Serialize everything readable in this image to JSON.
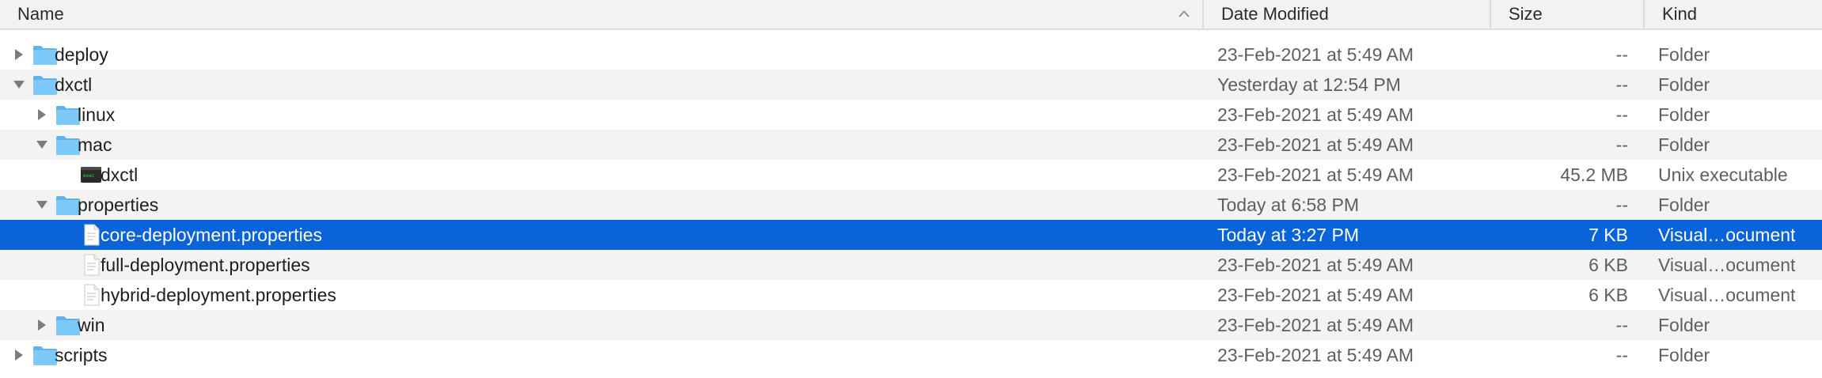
{
  "columns": {
    "name": "Name",
    "date": "Date Modified",
    "size": "Size",
    "kind": "Kind"
  },
  "sort": {
    "column": "name",
    "direction": "ascending"
  },
  "colors": {
    "selection": "#0a63d8",
    "folder": "#6cbff4"
  },
  "rows": [
    {
      "name": "deploy",
      "date": "23-Feb-2021 at 5:49 AM",
      "size": "--",
      "kind": "Folder",
      "depth": 0,
      "icon": "folder-icon",
      "disclosure": "collapsed"
    },
    {
      "name": "dxctl",
      "date": "Yesterday at 12:54 PM",
      "size": "--",
      "kind": "Folder",
      "depth": 0,
      "icon": "folder-icon",
      "disclosure": "expanded"
    },
    {
      "name": "linux",
      "date": "23-Feb-2021 at 5:49 AM",
      "size": "--",
      "kind": "Folder",
      "depth": 1,
      "icon": "folder-icon",
      "disclosure": "collapsed"
    },
    {
      "name": "mac",
      "date": "23-Feb-2021 at 5:49 AM",
      "size": "--",
      "kind": "Folder",
      "depth": 1,
      "icon": "folder-icon",
      "disclosure": "expanded"
    },
    {
      "name": "dxctl",
      "date": "23-Feb-2021 at 5:49 AM",
      "size": "45.2 MB",
      "kind": "Unix executable",
      "depth": 2,
      "icon": "terminal-exec-icon",
      "disclosure": "none"
    },
    {
      "name": "properties",
      "date": "Today at 6:58 PM",
      "size": "--",
      "kind": "Folder",
      "depth": 1,
      "icon": "folder-icon",
      "disclosure": "expanded"
    },
    {
      "name": "core-deployment.properties",
      "date": "Today at 3:27 PM",
      "size": "7 KB",
      "kind": "Visual…ocument",
      "depth": 2,
      "icon": "document-icon",
      "disclosure": "none",
      "selected": true
    },
    {
      "name": "full-deployment.properties",
      "date": "23-Feb-2021 at 5:49 AM",
      "size": "6 KB",
      "kind": "Visual…ocument",
      "depth": 2,
      "icon": "document-icon",
      "disclosure": "none"
    },
    {
      "name": "hybrid-deployment.properties",
      "date": "23-Feb-2021 at 5:49 AM",
      "size": "6 KB",
      "kind": "Visual…ocument",
      "depth": 2,
      "icon": "document-icon",
      "disclosure": "none"
    },
    {
      "name": "win",
      "date": "23-Feb-2021 at 5:49 AM",
      "size": "--",
      "kind": "Folder",
      "depth": 1,
      "icon": "folder-icon",
      "disclosure": "collapsed"
    },
    {
      "name": "scripts",
      "date": "23-Feb-2021 at 5:49 AM",
      "size": "--",
      "kind": "Folder",
      "depth": 0,
      "icon": "folder-icon",
      "disclosure": "collapsed"
    }
  ]
}
